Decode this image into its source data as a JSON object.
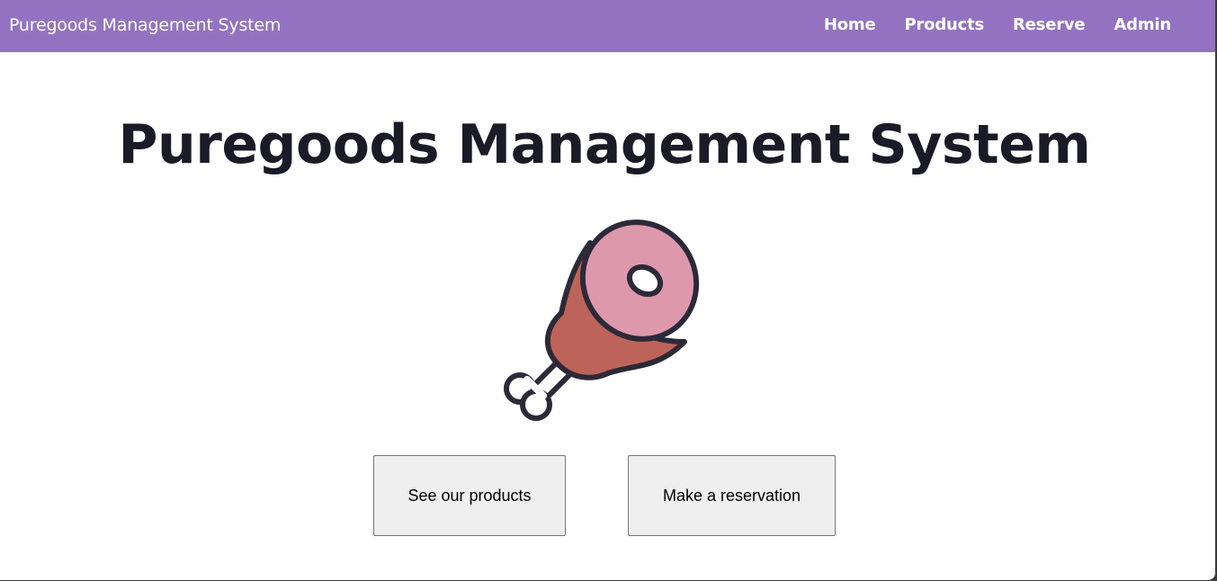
{
  "navbar": {
    "brand": "Puregoods Management System",
    "links": [
      "Home",
      "Products",
      "Reserve",
      "Admin"
    ]
  },
  "hero": {
    "title": "Puregoods Management System",
    "image_icon": "ham-icon"
  },
  "actions": {
    "products_label": "See our products",
    "reserve_label": "Make a reservation"
  },
  "colors": {
    "navbar": "#9373c1",
    "title": "#1b1a27",
    "ham_face": "#de98ac",
    "ham_meat": "#bd645a",
    "outline": "#2c2a38"
  }
}
